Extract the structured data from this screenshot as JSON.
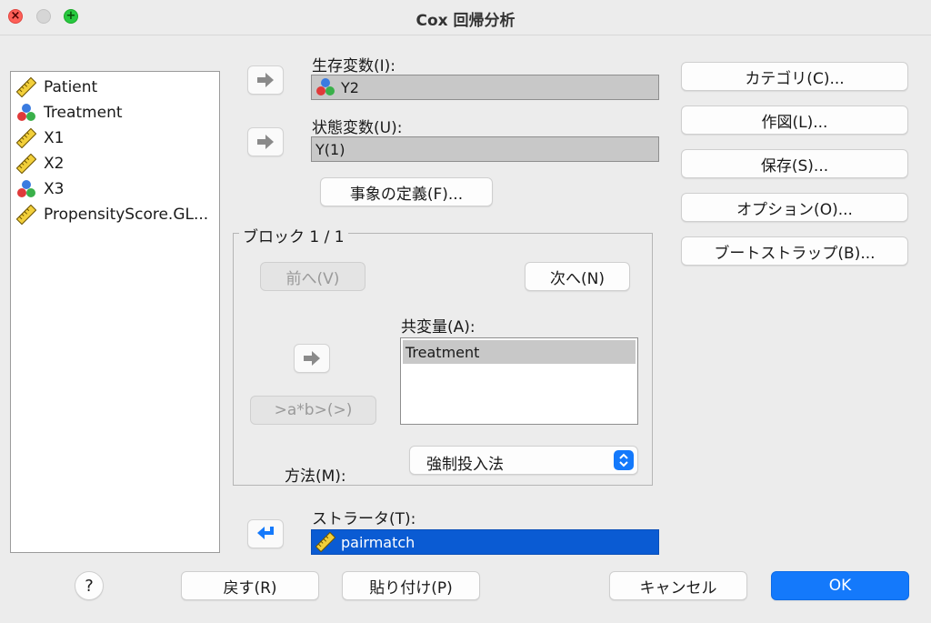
{
  "window": {
    "title": "Cox 回帰分析"
  },
  "variables": [
    {
      "label": "Patient",
      "icon": "scale-ruler-icon"
    },
    {
      "label": "Treatment",
      "icon": "nominal-balls-icon"
    },
    {
      "label": "X1",
      "icon": "scale-ruler-icon"
    },
    {
      "label": "X2",
      "icon": "scale-ruler-icon"
    },
    {
      "label": "X3",
      "icon": "nominal-balls-icon"
    },
    {
      "label": "PropensityScore.GL...",
      "icon": "scale-ruler-icon"
    }
  ],
  "survival": {
    "label": "生存変数(I):",
    "value": "Y2"
  },
  "status": {
    "label": "状態変数(U):",
    "value": "Y(1)"
  },
  "define_event_label": "事象の定義(F)...",
  "block": {
    "title": "ブロック 1 / 1",
    "prev_label": "前へ(V)",
    "next_label": "次へ(N)",
    "interaction_label": ">a*b>(>)",
    "covariates_label": "共変量(A):",
    "covariates": [
      "Treatment"
    ],
    "method_label": "方法(M):",
    "method_value": "強制投入法"
  },
  "strata": {
    "label": "ストラータ(T):",
    "value": "pairmatch"
  },
  "side_buttons": {
    "categorical": "カテゴリ(C)...",
    "plots": "作図(L)...",
    "save": "保存(S)...",
    "options": "オプション(O)...",
    "bootstrap": "ブートストラップ(B)..."
  },
  "footer": {
    "help": "?",
    "reset": "戻す(R)",
    "paste": "貼り付け(P)",
    "cancel": "キャンセル",
    "ok": "OK"
  },
  "colors": {
    "accent": "#1479fb",
    "selection": "#0a5bd3",
    "field_bg": "#c8c8c8"
  }
}
